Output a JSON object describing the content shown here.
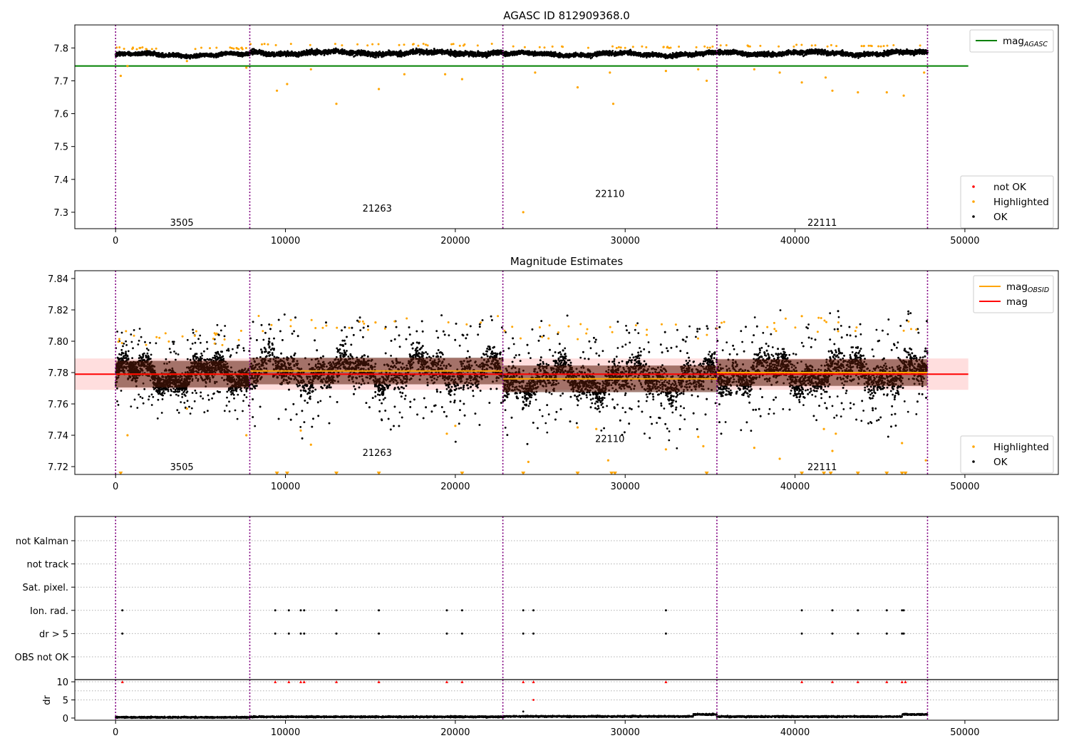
{
  "chart_data": [
    {
      "type": "scatter",
      "title": "AGASC ID 812909368.0",
      "xlim": [
        -2400,
        55500
      ],
      "ylim": [
        7.25,
        7.87
      ],
      "xticks": [
        0,
        10000,
        20000,
        30000,
        40000,
        50000
      ],
      "yticks": [
        7.3,
        7.4,
        7.5,
        7.6,
        7.7,
        7.8
      ],
      "xtick_labels": [
        "0",
        "10000",
        "20000",
        "30000",
        "40000",
        "50000"
      ],
      "ytick_labels": [
        "7.3",
        "7.4",
        "7.5",
        "7.6",
        "7.7",
        "7.8"
      ],
      "obs_boundaries": [
        0,
        7900,
        22800,
        35400,
        47800
      ],
      "obs_labels": [
        {
          "text": "3505",
          "x": 3900,
          "y": 7.27
        },
        {
          "text": "21263",
          "x": 15400,
          "y": 7.313
        },
        {
          "text": "22110",
          "x": 29100,
          "y": 7.357
        },
        {
          "text": "22111",
          "x": 41600,
          "y": 7.27
        }
      ],
      "reference_line": {
        "name": "mag_AGASC",
        "y": 7.745,
        "x": [
          -2400,
          50200
        ],
        "color": "#008000"
      },
      "ok_band": [
        {
          "x": [
            0,
            7900
          ],
          "mean": 7.779,
          "spread": 0.011
        },
        {
          "x": [
            7900,
            22800
          ],
          "mean": 7.785,
          "spread": 0.014
        },
        {
          "x": [
            22800,
            35400
          ],
          "mean": 7.781,
          "spread": 0.012
        },
        {
          "x": [
            35400,
            47800
          ],
          "mean": 7.784,
          "spread": 0.013
        }
      ],
      "highlighted_points": [
        [
          300,
          7.715
        ],
        [
          700,
          7.745
        ],
        [
          4200,
          7.76
        ],
        [
          7700,
          7.74
        ],
        [
          9500,
          7.67
        ],
        [
          10100,
          7.69
        ],
        [
          11500,
          7.735
        ],
        [
          13000,
          7.63
        ],
        [
          15500,
          7.675
        ],
        [
          17000,
          7.72
        ],
        [
          19400,
          7.72
        ],
        [
          20400,
          7.705
        ],
        [
          24000,
          7.3
        ],
        [
          24700,
          7.725
        ],
        [
          27200,
          7.68
        ],
        [
          29100,
          7.725
        ],
        [
          29300,
          7.63
        ],
        [
          32400,
          7.73
        ],
        [
          34300,
          7.735
        ],
        [
          34800,
          7.7
        ],
        [
          37600,
          7.735
        ],
        [
          39100,
          7.725
        ],
        [
          40400,
          7.695
        ],
        [
          41800,
          7.71
        ],
        [
          42200,
          7.67
        ],
        [
          43700,
          7.665
        ],
        [
          45400,
          7.665
        ],
        [
          46400,
          7.655
        ],
        [
          47600,
          7.725
        ]
      ],
      "legends": [
        {
          "position": "top-right",
          "entries": [
            {
              "label": "mag",
              "subscript": "AGASC",
              "color": "#008000",
              "kind": "line"
            }
          ]
        },
        {
          "position": "bottom-right",
          "entries": [
            {
              "label": "not OK",
              "color": "#ff0000",
              "kind": "dot"
            },
            {
              "label": "Highlighted",
              "color": "#ffa500",
              "kind": "dot"
            },
            {
              "label": "OK",
              "color": "#000000",
              "kind": "dot"
            }
          ]
        }
      ]
    },
    {
      "type": "scatter",
      "title": "Magnitude Estimates",
      "xlim": [
        -2400,
        55500
      ],
      "ylim": [
        7.715,
        7.845
      ],
      "xticks": [
        0,
        10000,
        20000,
        30000,
        40000,
        50000
      ],
      "yticks": [
        7.72,
        7.74,
        7.76,
        7.78,
        7.8,
        7.82,
        7.84
      ],
      "xtick_labels": [
        "0",
        "10000",
        "20000",
        "30000",
        "40000",
        "50000"
      ],
      "ytick_labels": [
        "7.72",
        "7.74",
        "7.76",
        "7.78",
        "7.80",
        "7.82",
        "7.84"
      ],
      "obs_boundaries": [
        0,
        7900,
        22800,
        35400,
        47800
      ],
      "obs_labels": [
        {
          "text": "3505",
          "x": 3900,
          "y": 7.72
        },
        {
          "text": "21263",
          "x": 15400,
          "y": 7.729
        },
        {
          "text": "22110",
          "x": 29100,
          "y": 7.738
        },
        {
          "text": "22111",
          "x": 41600,
          "y": 7.72
        }
      ],
      "mag_line": {
        "name": "mag",
        "y": 7.779,
        "x": [
          -2400,
          50200
        ],
        "band": [
          7.769,
          7.789
        ],
        "color": "#ff0000"
      },
      "mag_obsid": [
        {
          "x": [
            0,
            7900
          ],
          "y": 7.779
        },
        {
          "x": [
            7900,
            22800
          ],
          "y": 7.781
        },
        {
          "x": [
            22800,
            35400
          ],
          "y": 7.776
        },
        {
          "x": [
            35400,
            47800
          ],
          "y": 7.78
        }
      ],
      "ok_segments": [
        {
          "x": [
            0,
            7900
          ],
          "mean": 7.779,
          "spread": 0.016
        },
        {
          "x": [
            7900,
            22800
          ],
          "mean": 7.781,
          "spread": 0.022
        },
        {
          "x": [
            22800,
            35400
          ],
          "mean": 7.776,
          "spread": 0.022
        },
        {
          "x": [
            35400,
            47800
          ],
          "mean": 7.78,
          "spread": 0.022
        }
      ],
      "highlighted_points": [
        [
          700,
          7.74
        ],
        [
          4200,
          7.757
        ],
        [
          7700,
          7.74
        ],
        [
          10900,
          7.743
        ],
        [
          11500,
          7.734
        ],
        [
          15300,
          7.812
        ],
        [
          19500,
          7.741
        ],
        [
          20000,
          7.746
        ],
        [
          24300,
          7.723
        ],
        [
          27200,
          7.745
        ],
        [
          28300,
          7.744
        ],
        [
          29000,
          7.724
        ],
        [
          32400,
          7.731
        ],
        [
          34300,
          7.739
        ],
        [
          34600,
          7.733
        ],
        [
          37600,
          7.732
        ],
        [
          39100,
          7.725
        ],
        [
          40400,
          7.816
        ],
        [
          41700,
          7.744
        ],
        [
          42200,
          7.73
        ],
        [
          42400,
          7.741
        ],
        [
          46300,
          7.735
        ],
        [
          47700,
          7.724
        ]
      ],
      "clipped_points_x": [
        300,
        9500,
        10100,
        13000,
        15500,
        20400,
        24000,
        27200,
        29200,
        29400,
        34800,
        40400,
        41700,
        42100,
        43700,
        45400,
        46300,
        46500
      ],
      "legends": [
        {
          "position": "top-right",
          "entries": [
            {
              "label": "mag",
              "subscript": "OBSID",
              "color": "#ffa500",
              "kind": "line"
            },
            {
              "label": "mag",
              "subscript": "",
              "color": "#ff0000",
              "kind": "line"
            }
          ]
        },
        {
          "position": "bottom-right",
          "entries": [
            {
              "label": "Highlighted",
              "color": "#ffa500",
              "kind": "dot"
            },
            {
              "label": "OK",
              "color": "#000000",
              "kind": "dot"
            }
          ]
        }
      ]
    },
    {
      "type": "scatter",
      "title": "",
      "xlim": [
        -2400,
        55500
      ],
      "xticks": [
        0,
        10000,
        20000,
        30000,
        40000,
        50000
      ],
      "xtick_labels": [
        "0",
        "10000",
        "20000",
        "30000",
        "40000",
        "50000"
      ],
      "obs_boundaries": [
        0,
        7900,
        22800,
        35400,
        47800
      ],
      "flag_labels": [
        "not Kalman",
        "not track",
        "Sat. pixel.",
        "Ion. rad.",
        "dr > 5",
        "OBS not OK"
      ],
      "flag_points": {
        "Ion. rad.": [
          400,
          9400,
          10200,
          10900,
          11100,
          13000,
          15500,
          19500,
          20400,
          24000,
          24600,
          32400,
          40400,
          42200,
          43700,
          45400,
          46300,
          46400
        ],
        "dr > 5": [
          400,
          9400,
          10200,
          10900,
          11100,
          13000,
          15500,
          19500,
          20400,
          24000,
          24600,
          32400,
          40400,
          42200,
          43700,
          45400,
          46300,
          46400
        ]
      },
      "dr_ylabel": "dr",
      "dr_yticks": [
        0,
        5,
        10
      ],
      "dr_ytick_labels": [
        "0",
        "5",
        "10"
      ],
      "dr_ylim": [
        -0.6,
        10.6
      ],
      "dr_capped_x": [
        400,
        9400,
        10200,
        10900,
        11100,
        13000,
        15500,
        19500,
        20400,
        24000,
        24600,
        32400,
        40400,
        42200,
        43700,
        45400,
        46300,
        46500
      ],
      "dr_outliers": [
        [
          24000,
          1.8
        ],
        [
          24600,
          5.0
        ]
      ],
      "dr_baseline": [
        {
          "x": [
            0,
            7900
          ],
          "mean": 0.2
        },
        {
          "x": [
            7900,
            22800
          ],
          "mean": 0.35
        },
        {
          "x": [
            22800,
            34000
          ],
          "mean": 0.45
        },
        {
          "x": [
            34000,
            35400
          ],
          "mean": 1.0
        },
        {
          "x": [
            35400,
            46300
          ],
          "mean": 0.4
        },
        {
          "x": [
            46300,
            47800
          ],
          "mean": 1.0
        }
      ]
    }
  ],
  "colors": {
    "ok": "#000000",
    "highlighted": "#ffa500",
    "not_ok": "#ff0000",
    "agasc": "#008000",
    "boundary": "#800080",
    "band": "#ffc8c8"
  }
}
